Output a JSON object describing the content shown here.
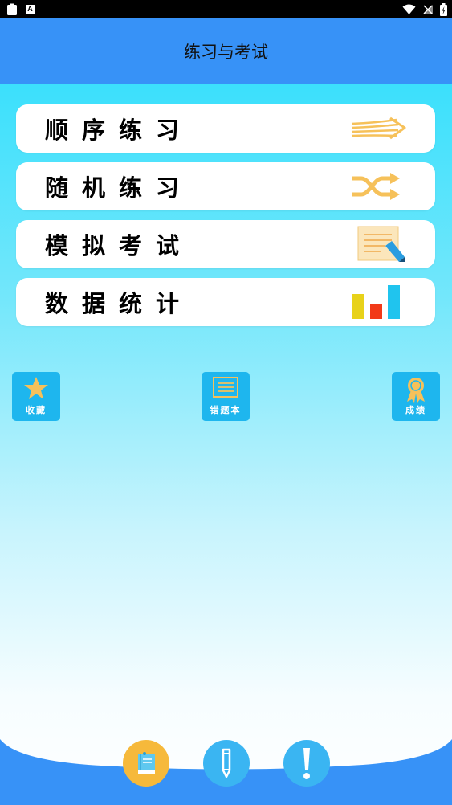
{
  "status_bar": {
    "notification_icons": [
      "clipboard-icon",
      "a-icon"
    ],
    "a_glyph": "A",
    "system_icons": [
      "wifi-icon",
      "signal-icon",
      "battery-icon"
    ]
  },
  "header": {
    "title": "练习与考试"
  },
  "menu": [
    {
      "label": "顺序练习",
      "icon": "arrows-icon"
    },
    {
      "label": "随机练习",
      "icon": "shuffle-icon"
    },
    {
      "label": "模拟考试",
      "icon": "exam-paper-icon"
    },
    {
      "label": "数据统计",
      "icon": "bar-stats-icon"
    }
  ],
  "quick": [
    {
      "label": "收藏",
      "icon": "star-icon"
    },
    {
      "label": "错题本",
      "icon": "notebook-icon"
    },
    {
      "label": "成绩",
      "icon": "award-icon"
    }
  ],
  "bottom_nav": [
    {
      "icon": "book-icon",
      "color": "#f6b93b"
    },
    {
      "icon": "pencil-icon",
      "color": "#3ab5f2"
    },
    {
      "icon": "exclamation-icon",
      "color": "#3ab5f2"
    }
  ],
  "colors": {
    "header": "#3792f7",
    "gradient_top": "#3be0fc",
    "quick_button": "#1eb6ee",
    "icon_gold": "#f6c15a",
    "bottom_bar": "#3792f7"
  }
}
